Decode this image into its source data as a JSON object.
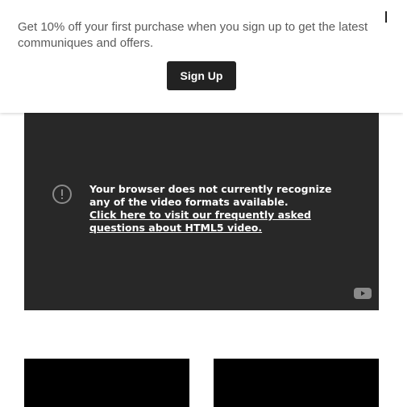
{
  "promo": {
    "text": "Get 10% off your first purchase when you sign up to get the latest communiques and offers.",
    "signup_label": "Sign Up"
  },
  "video": {
    "message": "Your browser does not currently recognize any of the video formats available.",
    "faq_link": "Click here to visit our frequently asked questions about HTML5 video."
  },
  "icons": {
    "warning": "exclamation-circle-icon",
    "brand": "youtube-icon"
  },
  "colors": {
    "button": "#222222",
    "player": "#282828",
    "promo_text": "#5b5b5b"
  }
}
